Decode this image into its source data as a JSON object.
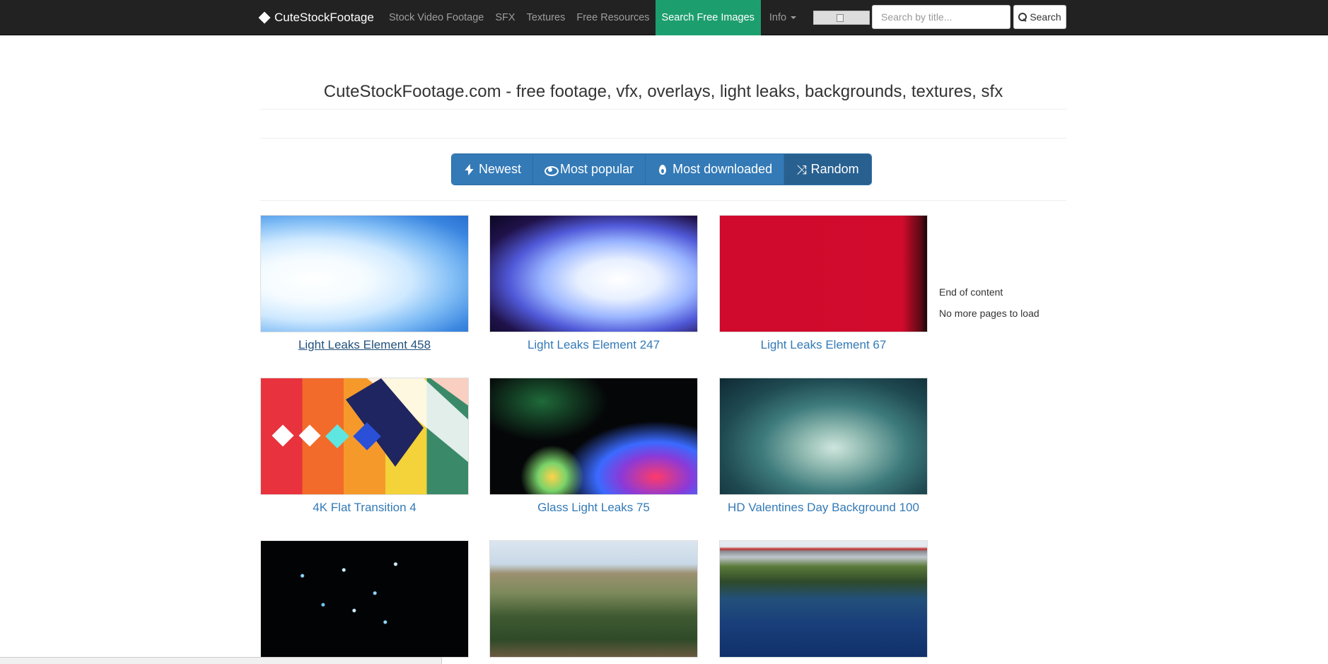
{
  "nav": {
    "brand": "CuteStockFootage",
    "links": [
      "Stock Video Footage",
      "SFX",
      "Textures",
      "Free Resources",
      "Search Free Images"
    ],
    "info_label": "Info",
    "search_placeholder": "Search by title...",
    "search_label": "Search"
  },
  "page_title": "CuteStockFootage.com - free footage, vfx, overlays, light leaks, backgrounds, textures, sfx",
  "sort_buttons": {
    "newest": "Newest",
    "popular": "Most popular",
    "downloaded": "Most downloaded",
    "random": "Random"
  },
  "items": [
    {
      "title": "Light Leaks Element 458"
    },
    {
      "title": "Light Leaks Element 247"
    },
    {
      "title": "Light Leaks Element 67"
    },
    {
      "title": "4K Flat Transition 4"
    },
    {
      "title": "Glass Light Leaks 75"
    },
    {
      "title": "HD Valentines Day Background 100"
    }
  ],
  "sidebar": {
    "end_text": "End of content",
    "no_more_text": "No more pages to load"
  },
  "colors": {
    "navbar": "#222222",
    "active_nav": "#1d9e6f",
    "button_primary": "#337ab7",
    "link": "#337ab7"
  }
}
